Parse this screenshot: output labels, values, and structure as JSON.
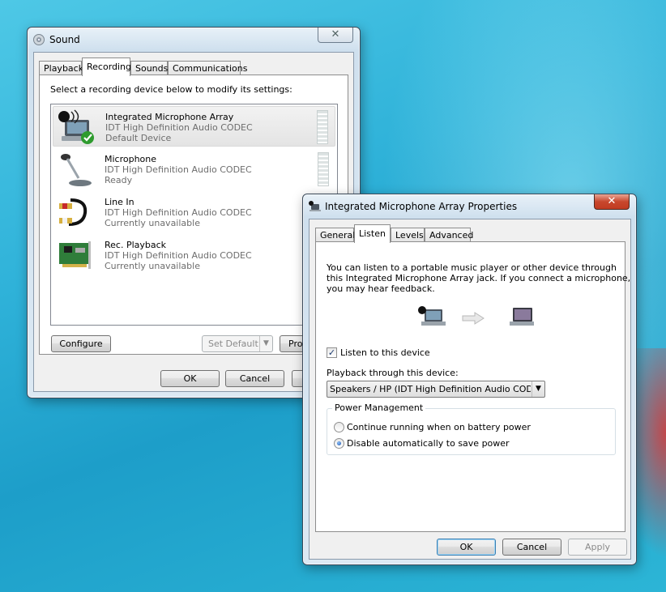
{
  "sound_window": {
    "title": "Sound",
    "tabs": [
      "Playback",
      "Recording",
      "Sounds",
      "Communications"
    ],
    "active_tab": "Recording",
    "instruction": "Select a recording device below to modify its settings:",
    "devices": [
      {
        "name": "Integrated Microphone Array",
        "driver": "IDT High Definition Audio CODEC",
        "status": "Default Device",
        "icon": "microphone-array-icon"
      },
      {
        "name": "Microphone",
        "driver": "IDT High Definition Audio CODEC",
        "status": "Ready",
        "icon": "microphone-icon"
      },
      {
        "name": "Line In",
        "driver": "IDT High Definition Audio CODEC",
        "status": "Currently unavailable",
        "icon": "line-in-cable-icon"
      },
      {
        "name": "Rec. Playback",
        "driver": "IDT High Definition Audio CODEC",
        "status": "Currently unavailable",
        "icon": "sound-card-icon"
      }
    ],
    "configure": "Configure",
    "set_default": "Set Default",
    "properties": "Prop",
    "ok": "OK",
    "cancel": "Cancel"
  },
  "props_window": {
    "title": "Integrated Microphone Array Properties",
    "tabs": [
      "General",
      "Listen",
      "Levels",
      "Advanced"
    ],
    "active_tab": "Listen",
    "description_1": "You can listen to a portable music player or other device through",
    "description_2": "this Integrated Microphone Array jack.  If you connect a microphone,",
    "description_3": "you may hear feedback.",
    "listen_checkbox": "Listen to this device",
    "listen_checked": true,
    "playback_label": "Playback through this device:",
    "playback_value": "Speakers / HP (IDT High Definition Audio CODEC",
    "power_group": "Power Management",
    "power_options": [
      "Continue running when on battery power",
      "Disable automatically to save power"
    ],
    "power_selected": 1,
    "ok": "OK",
    "cancel": "Cancel",
    "apply": "Apply"
  },
  "colors": {
    "accent": "#3c7fb1",
    "close_red": "#c8472d",
    "desktop": "#2fb2d9"
  }
}
